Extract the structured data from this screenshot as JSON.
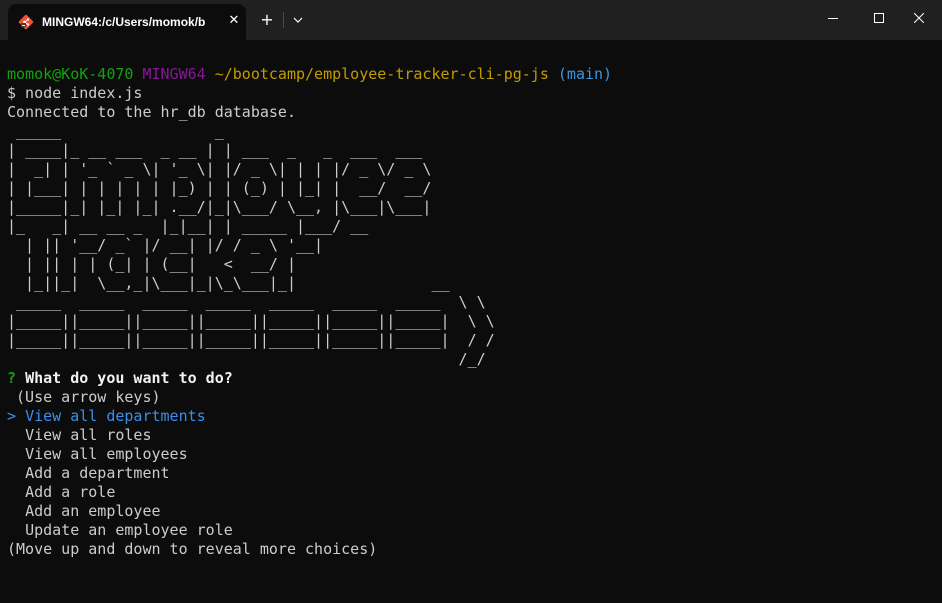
{
  "window": {
    "tab_title": "MINGW64:/c/Users/momok/b",
    "tab_close_glyph": "✕",
    "new_tab_glyph": "+",
    "colors": {
      "background": "#0c0c0c",
      "titlebar": "#202020",
      "text": "#cccccc",
      "green": "#13a10e",
      "purple": "#881798",
      "yellow": "#c19c00",
      "cyan": "#3a96dd",
      "selected": "#3b8eea"
    },
    "icons": {
      "tab": "git-bash-icon",
      "dropdown": "chevron-down-icon",
      "minimize": "minimize-icon",
      "maximize": "maximize-icon",
      "close": "close-icon"
    }
  },
  "terminal": {
    "prompt": {
      "user_host": "momok@KoK-4070",
      "system": "MINGW64",
      "path": "~/bootcamp/employee-tracker-cli-pg-js",
      "branch": "(main)"
    },
    "command": "$ node index.js",
    "connected_message": "Connected to the hr_db database.",
    "banner": " _____                 _\n| ____|_ __ ___  _ __ | | ___  _   _  ___  ___\n|  _| | '_ ` _ \\| '_ \\| |/ _ \\| | | |/ _ \\/ _ \\\n| |___| | | | | | |_) | | (_) | |_| |  __/  __/\n|_____|_| |_| |_| .__/|_|\\___/ \\__, |\\___|\\___|\n|_   _| __ __ _  |_|__| | _____ |___/ __\n  | || '__/ _` |/ __| |/ / _ \\ '__|\n  | || | | (_| | (__|   <  __/ |\n  |_||_|  \\__,_|\\___|_|\\_\\___|_|               __\n _____  _____  _____  _____  _____  _____  _____  \\ \\\n|_____||_____||_____||_____||_____||_____||_____|  \\ \\\n|_____||_____||_____||_____||_____||_____||_____|  / /\n                                                  /_/",
    "question_mark": "?",
    "question": "What do you want to do?",
    "hint": " (Use arrow keys)",
    "pointer": ">",
    "choices": [
      "View all departments",
      "View all roles",
      "View all employees",
      "Add a department",
      "Add a role",
      "Add an employee",
      "Update an employee role"
    ],
    "footer": "(Move up and down to reveal more choices)"
  }
}
